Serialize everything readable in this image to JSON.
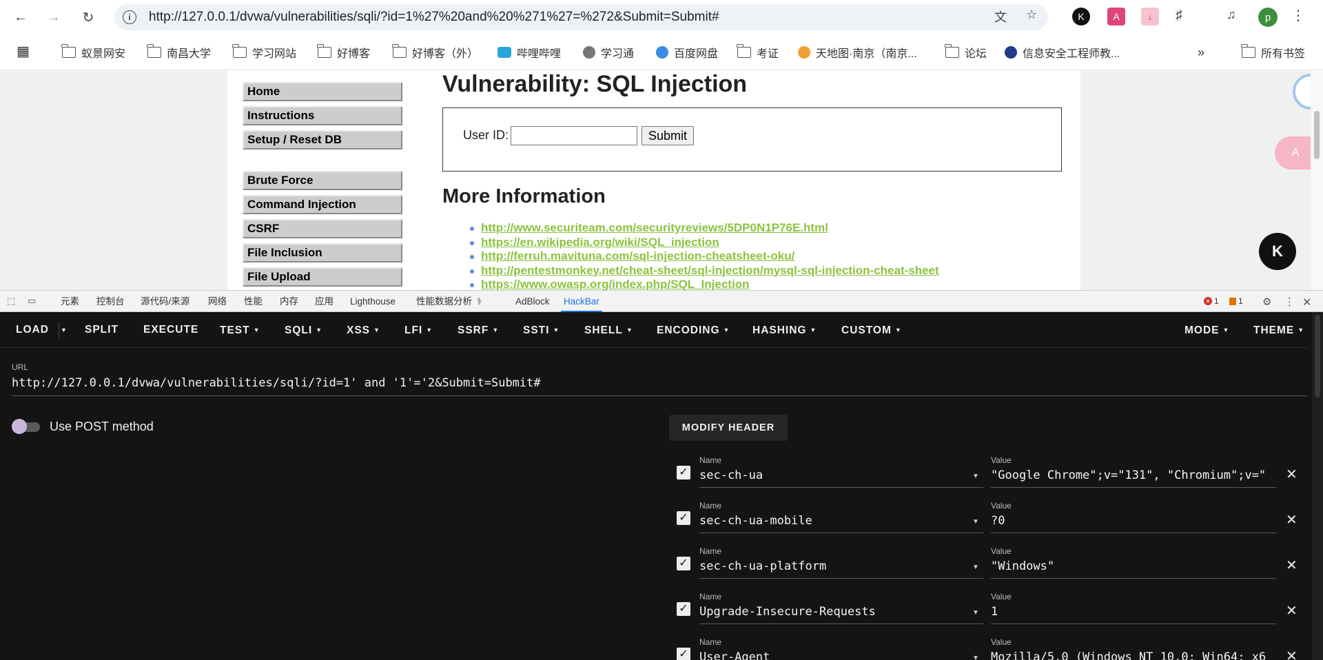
{
  "browser": {
    "url": "http://127.0.0.1/dvwa/vulnerabilities/sqli/?id=1%27%20and%20%271%27=%272&Submit=Submit#",
    "avatar_letter": "p",
    "bookmarks": [
      {
        "label": "蚁景网安",
        "icon": "folder-icon"
      },
      {
        "label": "南昌大学",
        "icon": "folder-icon"
      },
      {
        "label": "学习网站",
        "icon": "folder-icon"
      },
      {
        "label": "好博客",
        "icon": "folder-icon"
      },
      {
        "label": "好博客（外）",
        "icon": "folder-icon"
      },
      {
        "label": "哔哩哔哩",
        "icon": "bilibili-icon"
      },
      {
        "label": "学习通",
        "icon": "globe-icon"
      },
      {
        "label": "百度网盘",
        "icon": "baidu-netdisk-icon"
      },
      {
        "label": "考证",
        "icon": "folder-icon"
      },
      {
        "label": "天地图·南京（南京...",
        "icon": "tianditu-icon"
      },
      {
        "label": "论坛",
        "icon": "folder-icon"
      },
      {
        "label": "信息安全工程师教...",
        "icon": "r-logo-icon"
      }
    ],
    "all_bookmarks": "所有书签"
  },
  "dvwa": {
    "menu": [
      "Home",
      "Instructions",
      "Setup / Reset DB",
      "Brute Force",
      "Command Injection",
      "CSRF",
      "File Inclusion",
      "File Upload"
    ],
    "title": "Vulnerability: SQL Injection",
    "user_id_label": "User ID:",
    "submit_label": "Submit",
    "more_info": "More Information",
    "links": [
      "http://www.securiteam.com/securityreviews/5DP0N1P76E.html",
      "https://en.wikipedia.org/wiki/SQL_injection",
      "http://ferruh.mavituna.com/sql-injection-cheatsheet-oku/",
      "http://pentestmonkey.net/cheat-sheet/sql-injection/mysql-sql-injection-cheat-sheet",
      "https://www.owasp.org/index.php/SQL_Injection"
    ]
  },
  "devtools": {
    "tabs": [
      "元素",
      "控制台",
      "源代码/来源",
      "网络",
      "性能",
      "内存",
      "应用",
      "Lighthouse",
      "性能数据分析",
      "AdBlock",
      "HackBar"
    ],
    "active_tab": "HackBar",
    "errors": "1",
    "warnings": "1"
  },
  "hackbar": {
    "toolbar": [
      "LOAD",
      "SPLIT",
      "EXECUTE",
      "TEST",
      "SQLI",
      "XSS",
      "LFI",
      "SSRF",
      "SSTI",
      "SHELL",
      "ENCODING",
      "HASHING",
      "CUSTOM"
    ],
    "right": [
      "MODE",
      "THEME"
    ],
    "url_label": "URL",
    "url_value": "http://127.0.0.1/dvwa/vulnerabilities/sqli/?id=1' and '1'='2&Submit=Submit#",
    "post_label": "Use POST method",
    "post_enabled": false,
    "modify_header": "MODIFY HEADER",
    "name_label": "Name",
    "value_label": "Value",
    "headers": [
      {
        "name": "sec-ch-ua",
        "value": "\"Google Chrome\";v=\"131\", \"Chromium\";v=\"",
        "checked": true
      },
      {
        "name": "sec-ch-ua-mobile",
        "value": "?0",
        "checked": true
      },
      {
        "name": "sec-ch-ua-platform",
        "value": "\"Windows\"",
        "checked": true
      },
      {
        "name": "Upgrade-Insecure-Requests",
        "value": "1",
        "checked": true
      },
      {
        "name": "User-Agent",
        "value": "Mozilla/5.0 (Windows NT 10.0; Win64; x6",
        "checked": true
      }
    ]
  }
}
